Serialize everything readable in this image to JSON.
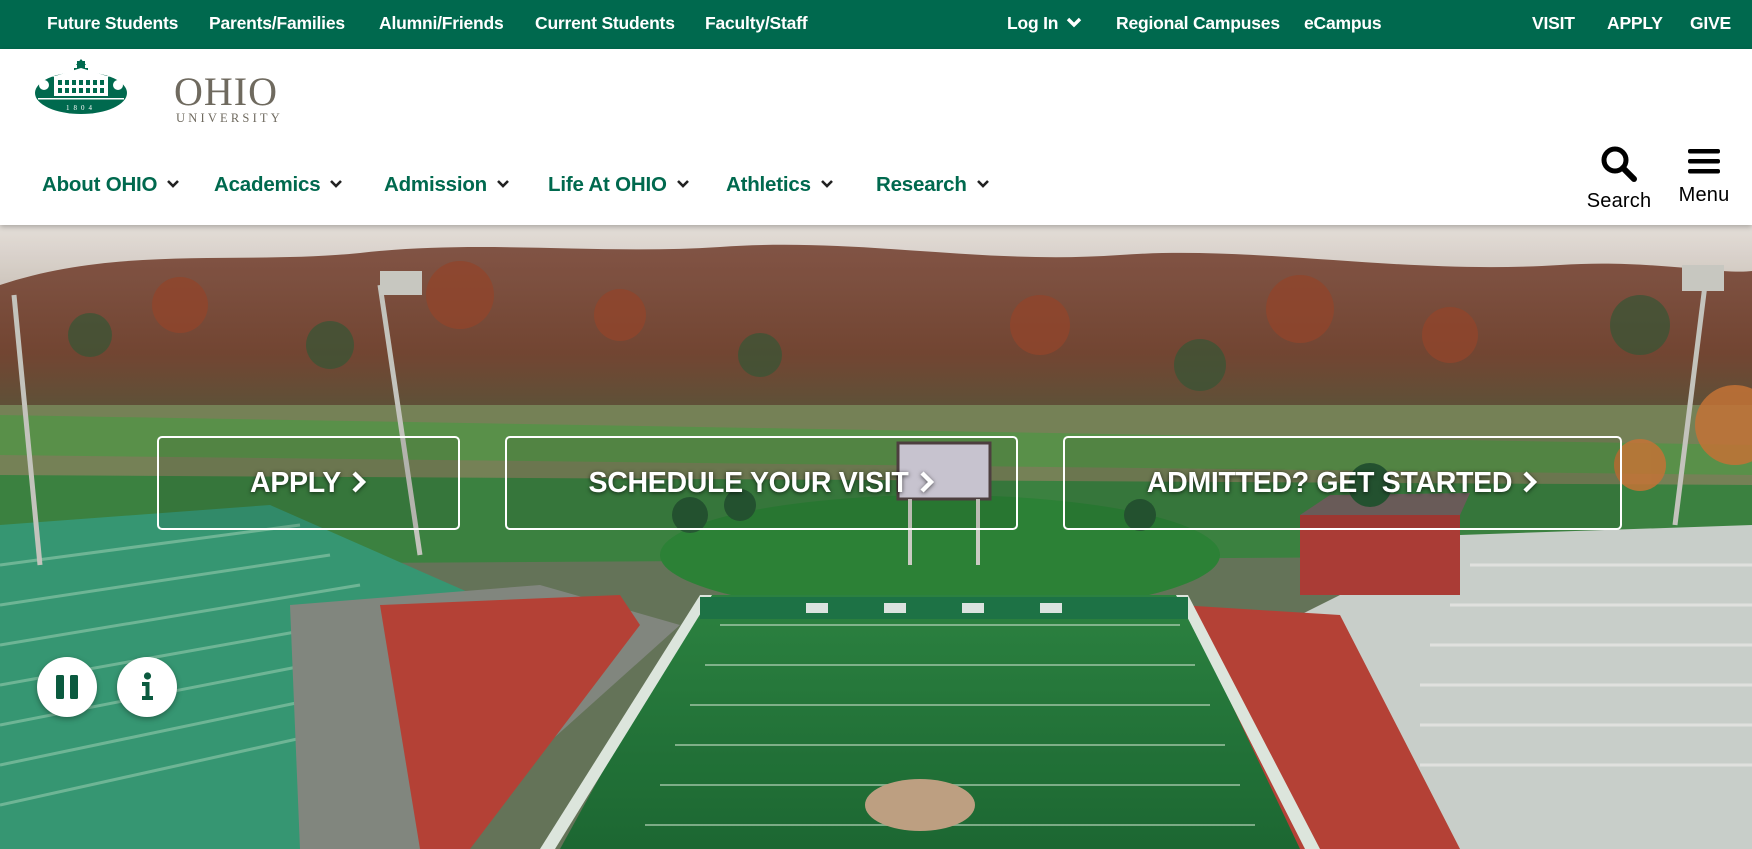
{
  "top_bar": {
    "left_links": [
      "Future Students",
      "Parents/Families",
      "Alumni/Friends",
      "Current Students",
      "Faculty/Staff"
    ],
    "login": "Log In",
    "mid_links": [
      "Regional Campuses",
      "eCampus"
    ],
    "right_links": [
      "VISIT",
      "APPLY",
      "GIVE"
    ]
  },
  "logo": {
    "word": "OHIO",
    "sub": "UNIVERSITY",
    "year": "1804"
  },
  "main_nav": [
    "About OHIO",
    "Academics",
    "Admission",
    "Life At OHIO",
    "Athletics",
    "Research"
  ],
  "utility": {
    "search": "Search",
    "menu": "Menu"
  },
  "hero": {
    "cta": [
      "APPLY",
      "SCHEDULE YOUR VISIT",
      "ADMITTED? GET STARTED"
    ],
    "pause_icon": "pause-icon",
    "info_icon": "info-icon"
  },
  "colors": {
    "brand_green": "#00694e",
    "logo_gray": "#6f6a5f"
  }
}
